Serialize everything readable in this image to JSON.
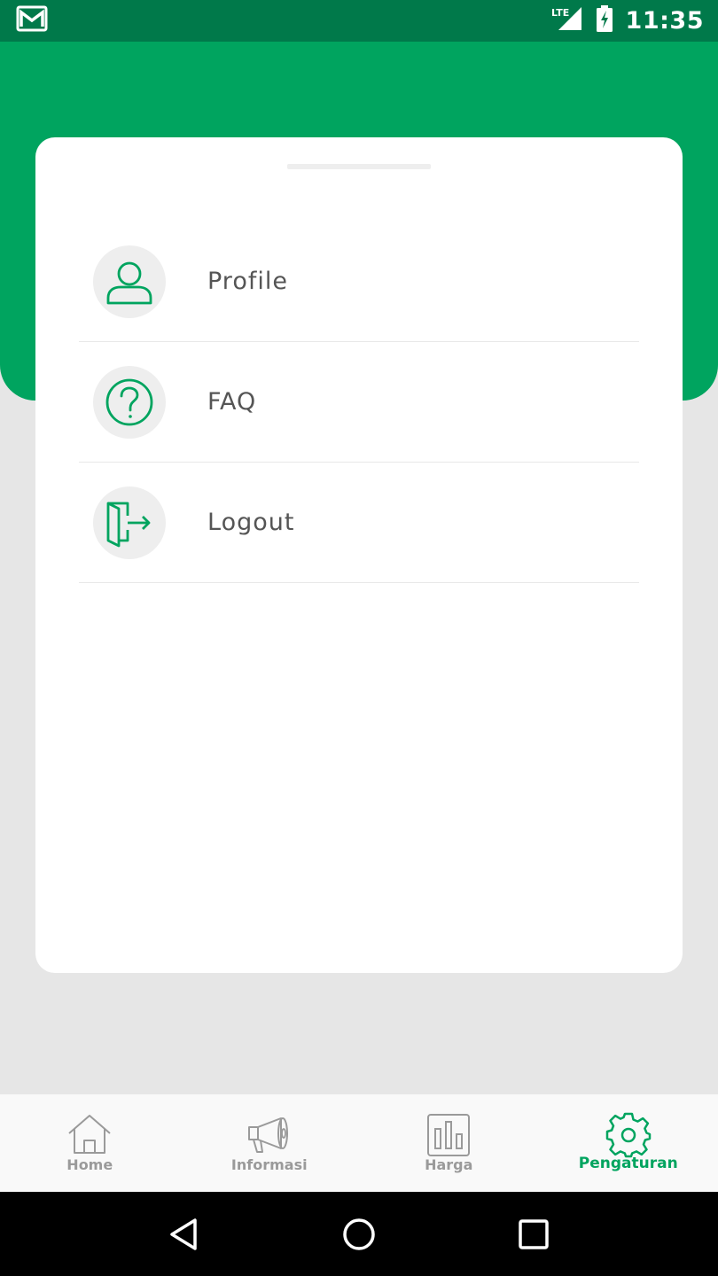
{
  "status_bar": {
    "time": "11:35",
    "network": "LTE",
    "icons": [
      "gmail-icon",
      "signal-icon",
      "battery-charging-icon"
    ]
  },
  "menu": {
    "items": [
      {
        "label": "Profile",
        "icon": "user-icon"
      },
      {
        "label": "FAQ",
        "icon": "question-circle-icon"
      },
      {
        "label": "Logout",
        "icon": "logout-door-icon"
      }
    ]
  },
  "bottom_nav": {
    "items": [
      {
        "label": "Home",
        "icon": "home-icon",
        "active": false
      },
      {
        "label": "Informasi",
        "icon": "megaphone-icon",
        "active": false
      },
      {
        "label": "Harga",
        "icon": "bar-chart-icon",
        "active": false
      },
      {
        "label": "Pengaturan",
        "icon": "gear-icon",
        "active": true
      }
    ]
  },
  "system_nav": {
    "icons": [
      "back-icon",
      "home-circle-icon",
      "recents-icon"
    ]
  },
  "colors": {
    "primary_green": "#00a45f",
    "status_bar_green": "#00794a",
    "background_gray": "#e6e6e6",
    "inactive_gray": "#9a9a9a",
    "label_gray": "#555555"
  }
}
